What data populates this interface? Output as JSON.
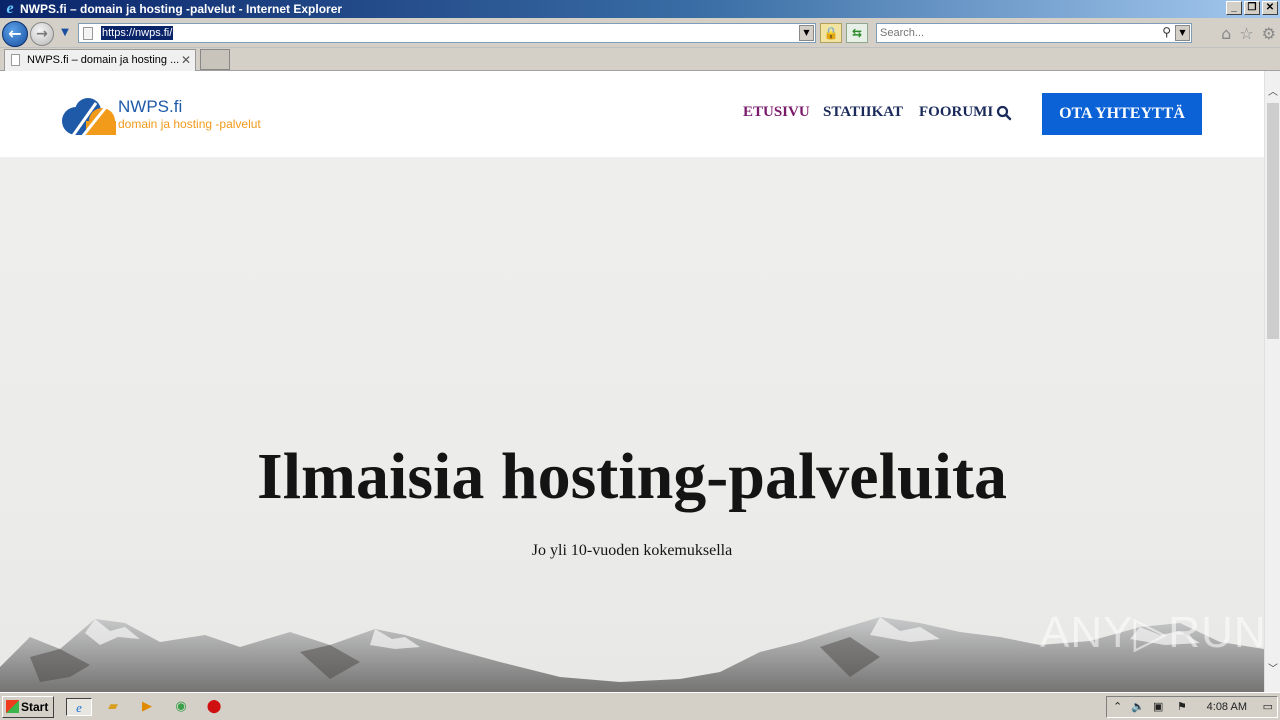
{
  "window": {
    "title": "NWPS.fi – domain ja hosting -palvelut - Internet Explorer",
    "minimize": "_",
    "restore": "❐",
    "close": "✕"
  },
  "navbar": {
    "url": "https://nwps.fi/",
    "search_placeholder": "Search..."
  },
  "tab": {
    "label": "NWPS.fi – domain ja hosting ...",
    "close": "✕"
  },
  "site": {
    "brand": "NWPS.fi",
    "tagline": "domain ja hosting -palvelut",
    "nav": [
      {
        "label": "ETUSIVU",
        "active": true
      },
      {
        "label": "STATIIKAT",
        "active": false
      },
      {
        "label": "FOORUMI",
        "active": false
      }
    ],
    "cta": "OTA YHTEYTTÄ",
    "hero_title": "Ilmaisia hosting-palveluita",
    "hero_subtitle": "Jo yli 10-vuoden kokemuksella",
    "watermark": "ANY▷RUN"
  },
  "colors": {
    "brand_blue": "#1f5aa8",
    "brand_orange": "#f29a1a",
    "cta_blue": "#0a62d6",
    "nav_active": "#7a1a6a",
    "nav_text": "#1a2a5a"
  },
  "taskbar": {
    "start": "Start",
    "clock": "4:08 AM"
  }
}
